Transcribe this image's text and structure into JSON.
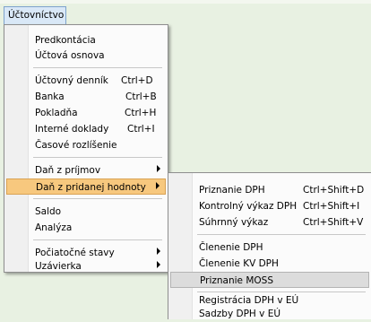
{
  "menubar": {
    "title": "Účtovníctvo"
  },
  "main_menu": {
    "items": [
      {
        "label": "Predkontácia"
      },
      {
        "label": "Účtová osnova"
      },
      {
        "label": "Účtovný denník",
        "shortcut": "Ctrl+D"
      },
      {
        "label": "Banka",
        "shortcut": "Ctrl+B"
      },
      {
        "label": "Pokladňa",
        "shortcut": "Ctrl+H"
      },
      {
        "label": "Interné doklady",
        "shortcut": "Ctrl+I"
      },
      {
        "label": "Časové rozlíšenie"
      },
      {
        "label": "Daň z príjmov"
      },
      {
        "label": "Daň z pridanej hodnoty"
      },
      {
        "label": "Saldo"
      },
      {
        "label": "Analýza"
      },
      {
        "label": "Počiatočné stavy"
      },
      {
        "label": "Uzávierka"
      }
    ]
  },
  "submenu_dph": {
    "items": [
      {
        "label": "Priznanie DPH",
        "shortcut": "Ctrl+Shift+D"
      },
      {
        "label": "Kontrolný výkaz DPH",
        "shortcut": "Ctrl+Shift+I"
      },
      {
        "label": "Súhrnný výkaz",
        "shortcut": "Ctrl+Shift+V"
      },
      {
        "label": "Členenie DPH"
      },
      {
        "label": "Členenie KV DPH"
      },
      {
        "label": "Priznanie MOSS"
      },
      {
        "label": "Registrácia DPH v EÚ"
      },
      {
        "label": "Sadzby DPH v EÚ"
      }
    ]
  },
  "colors": {
    "highlight": "#f7c87e",
    "background": "#e8f1e2"
  }
}
